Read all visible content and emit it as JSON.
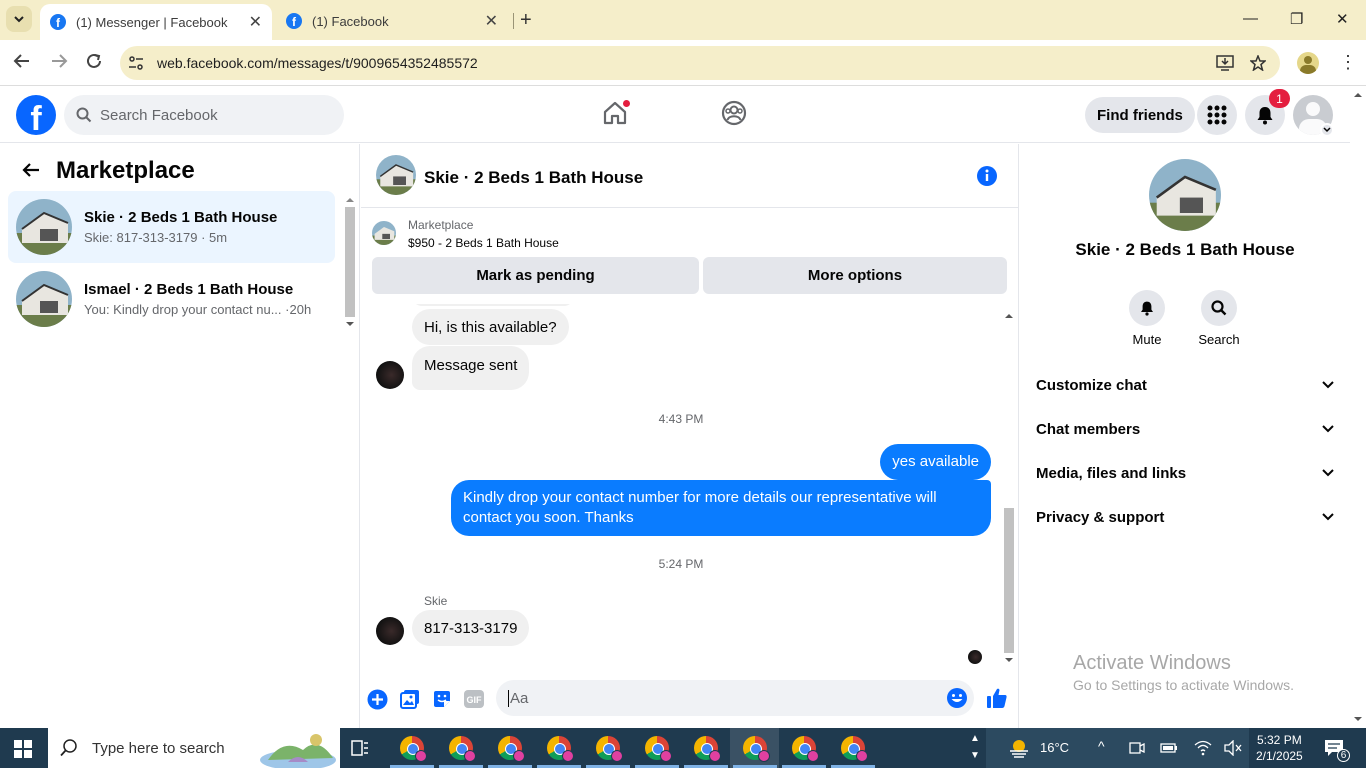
{
  "browser": {
    "tabs": [
      {
        "title": "(1) Messenger | Facebook",
        "active": true
      },
      {
        "title": "(1) Facebook",
        "active": false
      }
    ],
    "url": "web.facebook.com/messages/t/9009654352485572"
  },
  "fb_header": {
    "logo": "f",
    "search_placeholder": "Search Facebook",
    "find_friends": "Find friends",
    "notification_count": "1"
  },
  "left_panel": {
    "title": "Marketplace",
    "conversations": [
      {
        "name": "Skie · 2 Beds 1 Bath House",
        "preview": "Skie: 817-313-3179",
        "time": "5m",
        "active": true
      },
      {
        "name": "Ismael · 2 Beds 1 Bath House",
        "preview": "You: Kindly drop your contact nu...",
        "time": "20h",
        "active": false
      }
    ]
  },
  "chat": {
    "title": "Skie · 2 Beds 1 Bath House",
    "listing_label": "Marketplace",
    "listing_price": "$950 - 2 Beds 1 Bath House",
    "mark_pending": "Mark as pending",
    "more_options": "More options",
    "messages": {
      "m1": "Hi, is this available?",
      "m2": "Message sent",
      "time1": "4:43 PM",
      "m3": "yes available",
      "m4": "Kindly drop your contact number for more details our representative will contact you soon. Thanks",
      "time2": "5:24 PM",
      "sender": "Skie",
      "m5": "817-313-3179"
    },
    "composer_placeholder": "Aa"
  },
  "right_panel": {
    "name": "Skie · 2 Beds 1 Bath House",
    "mute": "Mute",
    "search": "Search",
    "sections": [
      "Customize chat",
      "Chat members",
      "Media, files and links",
      "Privacy & support"
    ],
    "activate_title": "Activate Windows",
    "activate_sub": "Go to Settings to activate Windows."
  },
  "taskbar": {
    "search_placeholder": "Type here to search",
    "temperature": "16°C",
    "time": "5:32 PM",
    "date": "2/1/2025",
    "notification_count": "6"
  },
  "colors": {
    "fb_blue": "#0866ff",
    "outgoing_bubble": "#0a7cff",
    "active_conv": "#ebf5ff",
    "chrome_tab_bg": "#f5eeca",
    "taskbar": "#1f3a4f"
  }
}
